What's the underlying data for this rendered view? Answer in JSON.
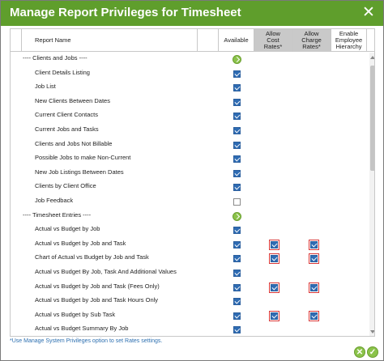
{
  "dialog": {
    "title": "Manage Report Privileges for Timesheet",
    "close_glyph": "✕",
    "footnote": "*Use Manage System Privileges option to set Rates settings.",
    "buttons": {
      "cancel_glyph": "✕",
      "save_glyph": "✓"
    }
  },
  "table": {
    "headers": {
      "report_name": "Report Name",
      "available": "Available",
      "allow_cost": "Allow Cost Rates*",
      "allow_charge": "Allow Charge Rates*",
      "enable_hierarchy": "Enable Employee Hierarchy"
    },
    "rows": [
      {
        "label": "---- Clients and Jobs ----",
        "section": true
      },
      {
        "label": "Client Details Listing",
        "available": true
      },
      {
        "label": "Job List",
        "available": true
      },
      {
        "label": "New Clients Between Dates",
        "available": true
      },
      {
        "label": "Current Client Contacts",
        "available": true
      },
      {
        "label": "Current Jobs and Tasks",
        "available": true
      },
      {
        "label": "Clients and Jobs Not Billable",
        "available": true
      },
      {
        "label": "Possible Jobs to make Non-Current",
        "available": true
      },
      {
        "label": "New Job Listings Between Dates",
        "available": true
      },
      {
        "label": "Clients by Client Office",
        "available": true
      },
      {
        "label": "Job Feedback",
        "available": false
      },
      {
        "label": "---- Timesheet Entries ----",
        "section": true
      },
      {
        "label": "Actual vs Budget by Job",
        "available": true
      },
      {
        "label": "Actual vs Budget by Job and Task",
        "available": true,
        "cost": true,
        "charge": true
      },
      {
        "label": "Chart of Actual vs Budget by Job and Task",
        "available": true,
        "cost": true,
        "charge": true
      },
      {
        "label": "Actual vs Budget By Job, Task And Additional Values",
        "available": true
      },
      {
        "label": "Actual vs Budget by Job and Task (Fees Only)",
        "available": true,
        "cost": true,
        "charge": true
      },
      {
        "label": "Actual vs Budget by Job and Task Hours Only",
        "available": true
      },
      {
        "label": "Actual vs Budget by Sub Task",
        "available": true,
        "cost": true,
        "charge": true
      },
      {
        "label": "Actual vs Budget Summary By Job",
        "available": true
      }
    ]
  },
  "colors": {
    "title_bar": "#5f9e2c",
    "checkbox_on": "#2f6cb3",
    "rate_highlight": "#d83a3a",
    "footnote": "#2c6fb0"
  }
}
